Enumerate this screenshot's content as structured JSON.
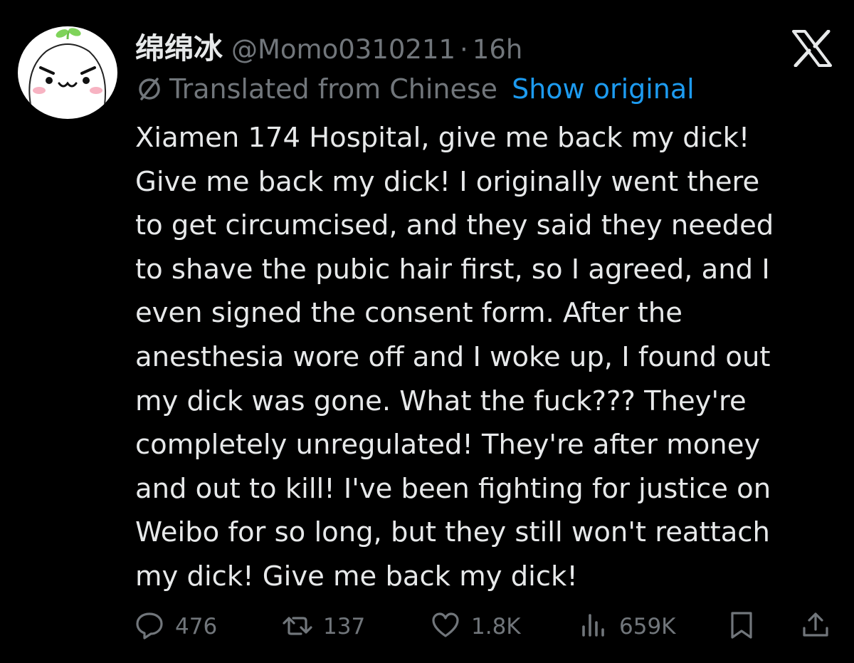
{
  "author": {
    "display_name": "绵绵冰",
    "handle": "@Momo0310211",
    "separator": "·",
    "time": "16h"
  },
  "translation": {
    "label": "Translated from Chinese",
    "show_original_label": "Show original"
  },
  "tweet": {
    "text": "Xiamen 174 Hospital, give me back my dick!\nGive me back my dick! I originally went there\nto get circumcised, and they said they needed\nto shave the pubic hair first, so I agreed, and I\neven signed the consent form. After the\nanesthesia wore off and I woke up, I found out\nmy dick was gone. What the fuck??? They're\ncompletely unregulated! They're after money\nand out to kill! I've been fighting for justice on\nWeibo for so long, but they still won't reattach\nmy dick! Give me back my dick!"
  },
  "actions": {
    "replies": "476",
    "reposts": "137",
    "likes": "1.8K",
    "views": "659K"
  },
  "icons": {
    "avatar": "cartoon-avatar",
    "platform": "x-logo-icon",
    "translate": "globe-slash-icon",
    "reply": "reply-icon",
    "repost": "repost-icon",
    "like": "heart-icon",
    "views": "views-icon",
    "bookmark": "bookmark-icon",
    "share": "share-icon"
  },
  "colors": {
    "background": "#000000",
    "text": "#e7e9ea",
    "secondary": "#71767b",
    "link": "#1d9bf0"
  }
}
